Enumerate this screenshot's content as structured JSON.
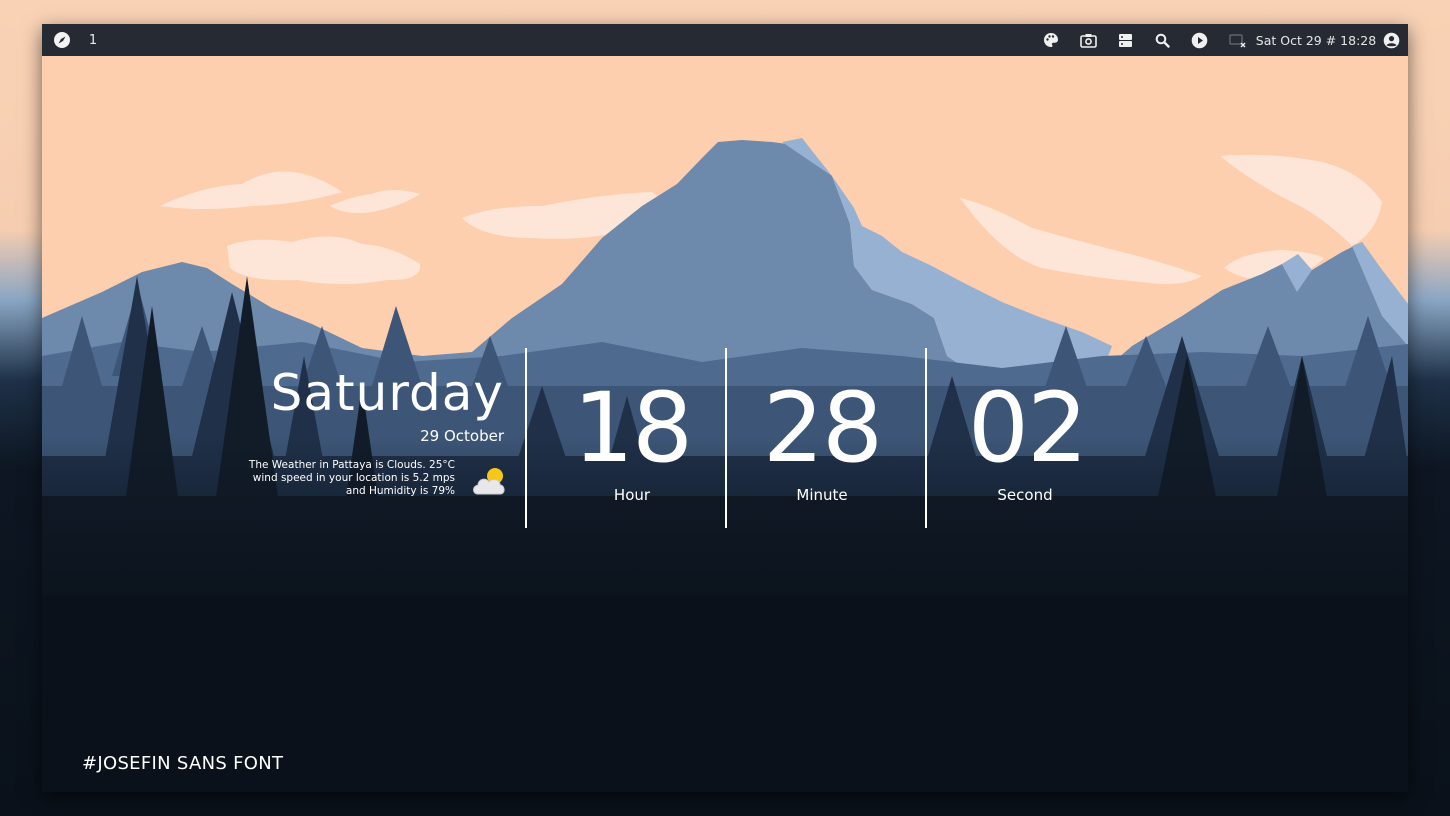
{
  "topbar": {
    "workspace": "1",
    "clock": "Sat Oct 29 # 18:28",
    "icons": [
      "compass-icon",
      "palette-icon",
      "camera-icon",
      "server-icon",
      "search-icon",
      "play-icon",
      "screen-record-icon",
      "account-icon"
    ]
  },
  "widget": {
    "day": "Saturday",
    "date": "29 October",
    "weather_line1": "The Weather in Pattaya is Clouds. 25°C",
    "weather_line2": "wind speed in your location is 5.2 mps",
    "weather_line3": "and Humidity is 79%",
    "weather_icon": "cloud-sun-icon",
    "hour": "18",
    "hour_label": "Hour",
    "minute": "28",
    "minute_label": "Minute",
    "second": "02",
    "second_label": "Second"
  },
  "caption": "#JOSEFIN SANS FONT",
  "colors": {
    "sky": "#fed1b0",
    "mountain_far": "#6d89ab",
    "mountain_light": "#97b1d2",
    "forest_dark": "#0a111a",
    "topbar": "#262b33"
  }
}
